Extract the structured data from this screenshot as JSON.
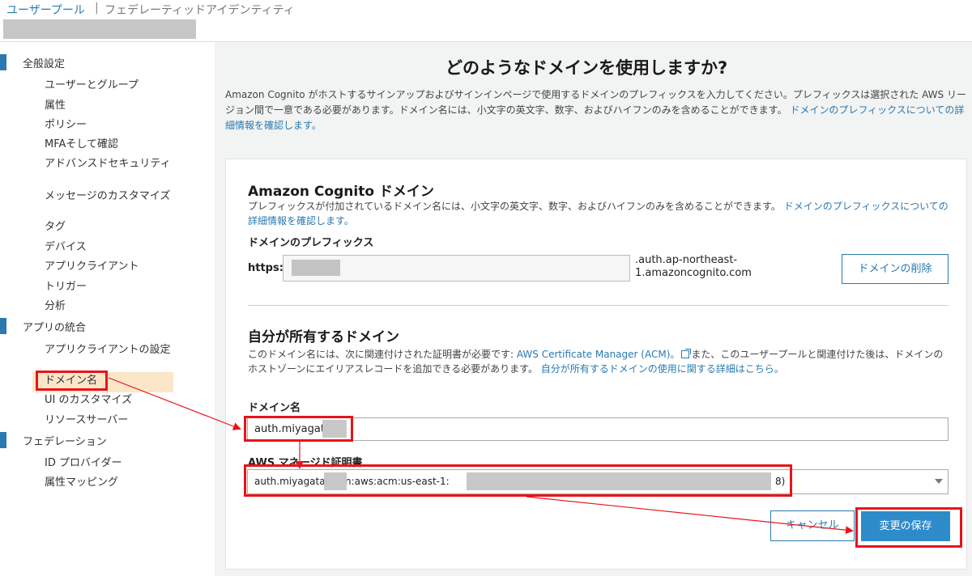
{
  "header": {
    "tab_user_pool": "ユーザープール",
    "separator": "|",
    "tab_federated": "フェデレーティッドアイデンティティ"
  },
  "sidebar": {
    "sections": [
      {
        "label": "全般設定"
      },
      {
        "label": "アプリの統合"
      },
      {
        "label": "フェデレーション"
      }
    ],
    "items": [
      {
        "label": "ユーザーとグループ"
      },
      {
        "label": "属性"
      },
      {
        "label": "ポリシー"
      },
      {
        "label": "MFAそして確認"
      },
      {
        "label": "アドバンスドセキュリティ"
      },
      {
        "label": "メッセージのカスタマイズ"
      },
      {
        "label": "タグ"
      },
      {
        "label": "デバイス"
      },
      {
        "label": "アプリクライアント"
      },
      {
        "label": "トリガー"
      },
      {
        "label": "分析"
      },
      {
        "label": "アプリクライアントの設定"
      },
      {
        "label": "ドメイン名",
        "active": true
      },
      {
        "label": "UI のカスタマイズ"
      },
      {
        "label": "リソースサーバー"
      },
      {
        "label": "ID プロバイダー"
      },
      {
        "label": "属性マッピング"
      }
    ]
  },
  "main": {
    "title": "どのようなドメインを使用しますか?",
    "description": "Amazon Cognito がホストするサインアップおよびサインインページで使用するドメインのプレフィックスを入力してください。プレフィックスは選択された AWS リージョン間で一意である必要があります。ドメイン名には、小文字の英文字、数字、およびハイフンのみを含めることができます。",
    "description_link": "ドメインのプレフィックスについての詳細情報を確認します。",
    "cognito": {
      "heading": "Amazon Cognito ドメイン",
      "text": "プレフィックスが付加されているドメイン名には、小文字の英文字、数字、およびハイフンのみを含めることができます。",
      "link": "ドメインのプレフィックスについての詳細情報を確認します。",
      "prefix_label": "ドメインのプレフィックス",
      "scheme": "https://",
      "suffix": ".auth.ap-northeast-1.amazoncognito.com",
      "delete_button": "ドメインの削除"
    },
    "own": {
      "heading": "自分が所有するドメイン",
      "text_before": "このドメイン名には、次に関連付けされた証明書が必要です: ",
      "acm_link": "AWS Certificate Manager (ACM)。",
      "text_after": "また、このユーザープールと関連付けた後は、ドメインのホストゾーンにエイリアスレコードを追加できる必要があります。",
      "link": "自分が所有するドメインの使用に関する詳細はこちら。",
      "domain_label": "ドメイン名",
      "domain_value": "auth.miyagata.",
      "cert_label": "AWS マネージド証明書",
      "cert_value": "auth.miyagata.       (arn:aws:acm:us-east-1:",
      "cert_tail": "8)"
    },
    "cancel_button": "キャンセル",
    "save_button": "変更の保存"
  },
  "colors": {
    "accent": "#2a7ab0",
    "primary_button": "#2e8bc9",
    "highlight": "#e8141a",
    "active_item_bg": "#fbe6c8"
  }
}
